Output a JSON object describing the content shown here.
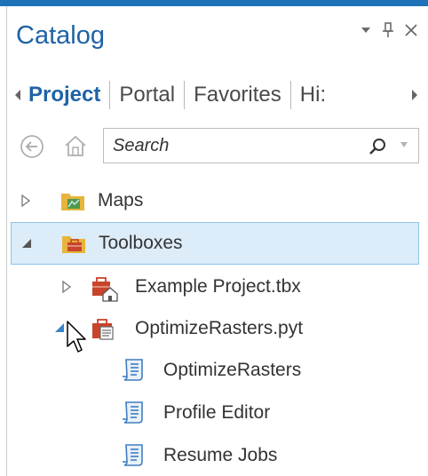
{
  "panel": {
    "title": "Catalog",
    "controls": {
      "pin": "Ф"
    }
  },
  "tabs": [
    {
      "label": "Project",
      "active": true
    },
    {
      "label": "Portal",
      "active": false
    },
    {
      "label": "Favorites",
      "active": false
    },
    {
      "label": "Hi:",
      "active": false
    }
  ],
  "search": {
    "placeholder": "Search"
  },
  "tree": {
    "maps": {
      "label": "Maps",
      "icon": "map-folder-icon"
    },
    "toolboxes": {
      "label": "Toolboxes",
      "icon": "toolbox-folder-icon"
    },
    "example": {
      "label": "Example Project.tbx",
      "icon": "home-toolbox-icon"
    },
    "optimize_pyt": {
      "label": "OptimizeRasters.pyt",
      "icon": "python-toolbox-icon"
    },
    "tool_optimize": {
      "label": "OptimizeRasters",
      "icon": "script-tool-icon"
    },
    "tool_profile": {
      "label": "Profile Editor",
      "icon": "script-tool-icon"
    },
    "tool_resume": {
      "label": "Resume Jobs",
      "icon": "script-tool-icon"
    }
  },
  "colors": {
    "accent": "#1f72b8",
    "title": "#1f62a6",
    "selection_bg": "#dcecf8",
    "selection_border": "#8fc3ea",
    "toolbox_red": "#c8442a"
  }
}
